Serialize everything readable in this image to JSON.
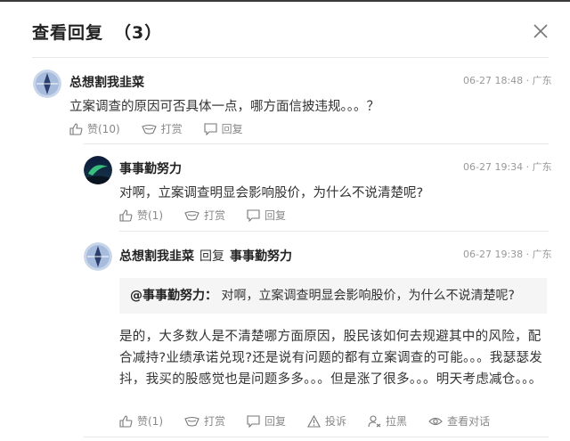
{
  "dialog": {
    "title": "查看回复",
    "count": "（3）"
  },
  "comments": [
    {
      "user": "总想割我韭菜",
      "time": "06-27 18:48 · 广东",
      "text": "立案调查的原因可否具体一点，哪方面信披违规。。。？",
      "like": "赞(10)",
      "tip": "打赏",
      "reply": "回复"
    },
    {
      "user": "事事勤努力",
      "time": "06-27 19:34 · 广东",
      "text": "对啊，立案调查明显会影响股价，为什么不说清楚呢?",
      "like": "赞(1)",
      "tip": "打赏",
      "reply": "回复"
    },
    {
      "user": "总想割我韭菜",
      "reply_word": "回复",
      "reply_to": "事事勤努力",
      "time": "06-27 19:38 · 广东",
      "quote_name": "@事事勤努力：",
      "quote_text": "对啊，立案调查明显会影响股价，为什么不说清楚呢?",
      "text": "是的，大多数人是不清楚哪方面原因，股民该如何去规避其中的风险，配合减持?业绩承诺兑现?还是说有问题的都有立案调查的可能。。。我瑟瑟发抖，我买的股感觉也是问题多多。。。但是涨了很多。。。明天考虑减仓。。。",
      "like": "赞(1)",
      "tip": "打赏",
      "reply": "回复",
      "report": "投诉",
      "block": "拉黑",
      "view_thread": "查看对话"
    }
  ],
  "colors": {
    "accent_dark": "#222222",
    "meta": "#999999",
    "action": "#888888"
  }
}
